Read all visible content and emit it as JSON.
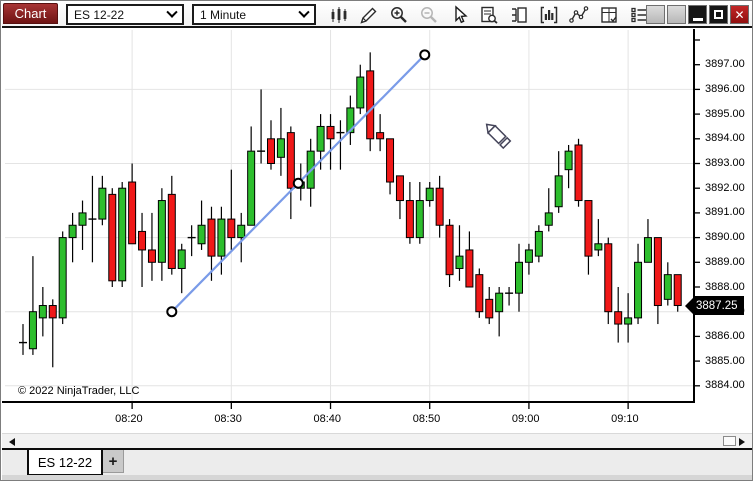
{
  "window": {
    "tab_title": "Chart"
  },
  "toolbar": {
    "instrument_select": {
      "value": "ES 12-22"
    },
    "interval_select": {
      "value": "1 Minute"
    },
    "icons": [
      "chart-style",
      "draw",
      "zoom-in",
      "zoom-out",
      "pointer",
      "data-box",
      "chart-trader",
      "indicators",
      "drawing-tools",
      "strategies",
      "properties"
    ],
    "window_buttons": [
      "blank",
      "blank",
      "minimize",
      "restore",
      "close"
    ],
    "close_glyph": "✕"
  },
  "chart_data": {
    "type": "candlestick",
    "instrument": "ES 12-22",
    "interval": "1 Minute",
    "copyright": "© 2022 NinjaTrader, LLC",
    "y_axis": {
      "tick_labels": [
        "3897.00",
        "3896.00",
        "3895.00",
        "3894.00",
        "3893.00",
        "3892.00",
        "3891.00",
        "3890.00",
        "3889.00",
        "3888.00",
        "3887.00",
        "3886.00",
        "3885.00",
        "3884.00"
      ],
      "grid_prices": [
        3896,
        3893,
        3890,
        3887,
        3884
      ],
      "last_price": "3887.25",
      "range_top": 3898.2,
      "range_bottom": 3883.7
    },
    "x_axis": {
      "tick_labels": [
        "08:20",
        "08:30",
        "08:40",
        "08:50",
        "09:00",
        "09:10"
      ]
    },
    "trend_line": {
      "start": {
        "time": "08:24",
        "price": 3887.0
      },
      "end": {
        "time": "08:49:30",
        "price": 3897.4
      },
      "handles": 3
    },
    "colors": {
      "up": "#2DBE2D",
      "down": "#F01818",
      "wick": "#000000",
      "trend": "#7A9BE8",
      "grid": "#E4E4E4"
    },
    "candles": [
      {
        "t": "08:09",
        "o": 3885.75,
        "h": 3886.5,
        "l": 3885.25,
        "c": 3885.75
      },
      {
        "t": "08:10",
        "o": 3885.5,
        "h": 3889.25,
        "l": 3885.25,
        "c": 3887.0
      },
      {
        "t": "08:11",
        "o": 3886.75,
        "h": 3888.0,
        "l": 3886.0,
        "c": 3887.25
      },
      {
        "t": "08:12",
        "o": 3887.25,
        "h": 3887.5,
        "l": 3884.75,
        "c": 3886.75
      },
      {
        "t": "08:13",
        "o": 3886.75,
        "h": 3890.25,
        "l": 3886.5,
        "c": 3890.0
      },
      {
        "t": "08:14",
        "o": 3890.0,
        "h": 3891.0,
        "l": 3889.0,
        "c": 3890.5
      },
      {
        "t": "08:15",
        "o": 3890.5,
        "h": 3891.5,
        "l": 3889.5,
        "c": 3891.0
      },
      {
        "t": "08:16",
        "o": 3890.75,
        "h": 3892.5,
        "l": 3889.0,
        "c": 3890.75
      },
      {
        "t": "08:17",
        "o": 3890.75,
        "h": 3892.5,
        "l": 3890.5,
        "c": 3892.0
      },
      {
        "t": "08:18",
        "o": 3891.75,
        "h": 3892.0,
        "l": 3888.0,
        "c": 3888.25
      },
      {
        "t": "08:19",
        "o": 3888.25,
        "h": 3892.25,
        "l": 3888.0,
        "c": 3892.0
      },
      {
        "t": "08:20",
        "o": 3892.25,
        "h": 3893.0,
        "l": 3889.75,
        "c": 3889.75
      },
      {
        "t": "08:21",
        "o": 3890.25,
        "h": 3891.0,
        "l": 3888.0,
        "c": 3889.5
      },
      {
        "t": "08:22",
        "o": 3889.5,
        "h": 3891.0,
        "l": 3888.25,
        "c": 3889.0
      },
      {
        "t": "08:23",
        "o": 3889.0,
        "h": 3892.0,
        "l": 3888.25,
        "c": 3891.5
      },
      {
        "t": "08:24",
        "o": 3891.75,
        "h": 3892.5,
        "l": 3888.5,
        "c": 3888.75
      },
      {
        "t": "08:25",
        "o": 3888.75,
        "h": 3889.75,
        "l": 3887.75,
        "c": 3889.5
      },
      {
        "t": "08:26",
        "o": 3890.0,
        "h": 3890.5,
        "l": 3889.25,
        "c": 3890.0
      },
      {
        "t": "08:27",
        "o": 3889.75,
        "h": 3891.5,
        "l": 3889.5,
        "c": 3890.5
      },
      {
        "t": "08:28",
        "o": 3890.75,
        "h": 3891.25,
        "l": 3888.25,
        "c": 3889.25
      },
      {
        "t": "08:29",
        "o": 3889.25,
        "h": 3891.25,
        "l": 3888.5,
        "c": 3890.75
      },
      {
        "t": "08:30",
        "o": 3890.75,
        "h": 3892.75,
        "l": 3889.5,
        "c": 3890.0
      },
      {
        "t": "08:31",
        "o": 3890.0,
        "h": 3891.0,
        "l": 3889.0,
        "c": 3890.5
      },
      {
        "t": "08:32",
        "o": 3890.5,
        "h": 3894.5,
        "l": 3890.5,
        "c": 3893.5
      },
      {
        "t": "08:33",
        "o": 3893.5,
        "h": 3896.0,
        "l": 3893.0,
        "c": 3893.5
      },
      {
        "t": "08:34",
        "o": 3894.0,
        "h": 3894.75,
        "l": 3892.75,
        "c": 3893.0
      },
      {
        "t": "08:35",
        "o": 3893.25,
        "h": 3895.25,
        "l": 3892.5,
        "c": 3894.0
      },
      {
        "t": "08:36",
        "o": 3894.25,
        "h": 3894.5,
        "l": 3890.75,
        "c": 3892.0
      },
      {
        "t": "08:37",
        "o": 3892.0,
        "h": 3893.0,
        "l": 3891.5,
        "c": 3892.25
      },
      {
        "t": "08:38",
        "o": 3892.0,
        "h": 3894.0,
        "l": 3891.25,
        "c": 3893.5
      },
      {
        "t": "08:39",
        "o": 3893.5,
        "h": 3895.0,
        "l": 3892.75,
        "c": 3894.5
      },
      {
        "t": "08:40",
        "o": 3894.5,
        "h": 3895.0,
        "l": 3892.75,
        "c": 3894.0
      },
      {
        "t": "08:41",
        "o": 3894.25,
        "h": 3894.75,
        "l": 3892.75,
        "c": 3894.25
      },
      {
        "t": "08:42",
        "o": 3894.25,
        "h": 3895.75,
        "l": 3893.75,
        "c": 3895.25
      },
      {
        "t": "08:43",
        "o": 3895.25,
        "h": 3897.0,
        "l": 3895.0,
        "c": 3896.5
      },
      {
        "t": "08:44",
        "o": 3896.75,
        "h": 3897.5,
        "l": 3893.5,
        "c": 3894.0
      },
      {
        "t": "08:45",
        "o": 3894.25,
        "h": 3895.0,
        "l": 3893.5,
        "c": 3894.0
      },
      {
        "t": "08:46",
        "o": 3894.0,
        "h": 3894.0,
        "l": 3891.75,
        "c": 3892.25
      },
      {
        "t": "08:47",
        "o": 3892.5,
        "h": 3892.5,
        "l": 3890.75,
        "c": 3891.5
      },
      {
        "t": "08:48",
        "o": 3891.5,
        "h": 3892.25,
        "l": 3889.75,
        "c": 3890.0
      },
      {
        "t": "08:49",
        "o": 3890.0,
        "h": 3892.25,
        "l": 3889.75,
        "c": 3891.5
      },
      {
        "t": "08:50",
        "o": 3891.5,
        "h": 3892.25,
        "l": 3891.25,
        "c": 3892.0
      },
      {
        "t": "08:51",
        "o": 3892.0,
        "h": 3892.5,
        "l": 3890.0,
        "c": 3890.5
      },
      {
        "t": "08:52",
        "o": 3890.5,
        "h": 3890.75,
        "l": 3888.0,
        "c": 3888.5
      },
      {
        "t": "08:53",
        "o": 3888.75,
        "h": 3890.5,
        "l": 3888.25,
        "c": 3889.25
      },
      {
        "t": "08:54",
        "o": 3889.5,
        "h": 3890.25,
        "l": 3888.0,
        "c": 3888.0
      },
      {
        "t": "08:55",
        "o": 3888.5,
        "h": 3888.75,
        "l": 3886.75,
        "c": 3887.0
      },
      {
        "t": "08:56",
        "o": 3887.5,
        "h": 3888.0,
        "l": 3886.5,
        "c": 3886.75
      },
      {
        "t": "08:57",
        "o": 3887.0,
        "h": 3888.0,
        "l": 3886.0,
        "c": 3887.75
      },
      {
        "t": "08:58",
        "o": 3887.75,
        "h": 3888.0,
        "l": 3887.25,
        "c": 3887.75
      },
      {
        "t": "08:59",
        "o": 3887.75,
        "h": 3889.75,
        "l": 3887.0,
        "c": 3889.0
      },
      {
        "t": "09:00",
        "o": 3889.0,
        "h": 3889.75,
        "l": 3888.5,
        "c": 3889.5
      },
      {
        "t": "09:01",
        "o": 3889.25,
        "h": 3890.5,
        "l": 3889.0,
        "c": 3890.25
      },
      {
        "t": "09:02",
        "o": 3890.5,
        "h": 3892.0,
        "l": 3890.25,
        "c": 3891.0
      },
      {
        "t": "09:03",
        "o": 3891.25,
        "h": 3893.5,
        "l": 3891.0,
        "c": 3892.5
      },
      {
        "t": "09:04",
        "o": 3892.75,
        "h": 3893.75,
        "l": 3892.0,
        "c": 3893.5
      },
      {
        "t": "09:05",
        "o": 3893.75,
        "h": 3894.0,
        "l": 3891.25,
        "c": 3891.5
      },
      {
        "t": "09:06",
        "o": 3891.5,
        "h": 3891.5,
        "l": 3888.5,
        "c": 3889.25
      },
      {
        "t": "09:07",
        "o": 3889.5,
        "h": 3890.75,
        "l": 3889.25,
        "c": 3889.75
      },
      {
        "t": "09:08",
        "o": 3889.75,
        "h": 3890.0,
        "l": 3886.5,
        "c": 3887.0
      },
      {
        "t": "09:09",
        "o": 3887.0,
        "h": 3888.0,
        "l": 3885.75,
        "c": 3886.5
      },
      {
        "t": "09:10",
        "o": 3886.5,
        "h": 3887.75,
        "l": 3885.75,
        "c": 3886.75
      },
      {
        "t": "09:11",
        "o": 3886.75,
        "h": 3889.75,
        "l": 3886.5,
        "c": 3889.0
      },
      {
        "t": "09:12",
        "o": 3889.0,
        "h": 3890.75,
        "l": 3889.0,
        "c": 3890.0
      },
      {
        "t": "09:13",
        "o": 3890.0,
        "h": 3890.0,
        "l": 3886.5,
        "c": 3887.25
      },
      {
        "t": "09:14",
        "o": 3887.5,
        "h": 3889.0,
        "l": 3887.25,
        "c": 3888.5
      },
      {
        "t": "09:15",
        "o": 3888.5,
        "h": 3888.5,
        "l": 3887.0,
        "c": 3887.25
      }
    ]
  },
  "tabs": {
    "active": "ES 12-22",
    "add": "+"
  }
}
